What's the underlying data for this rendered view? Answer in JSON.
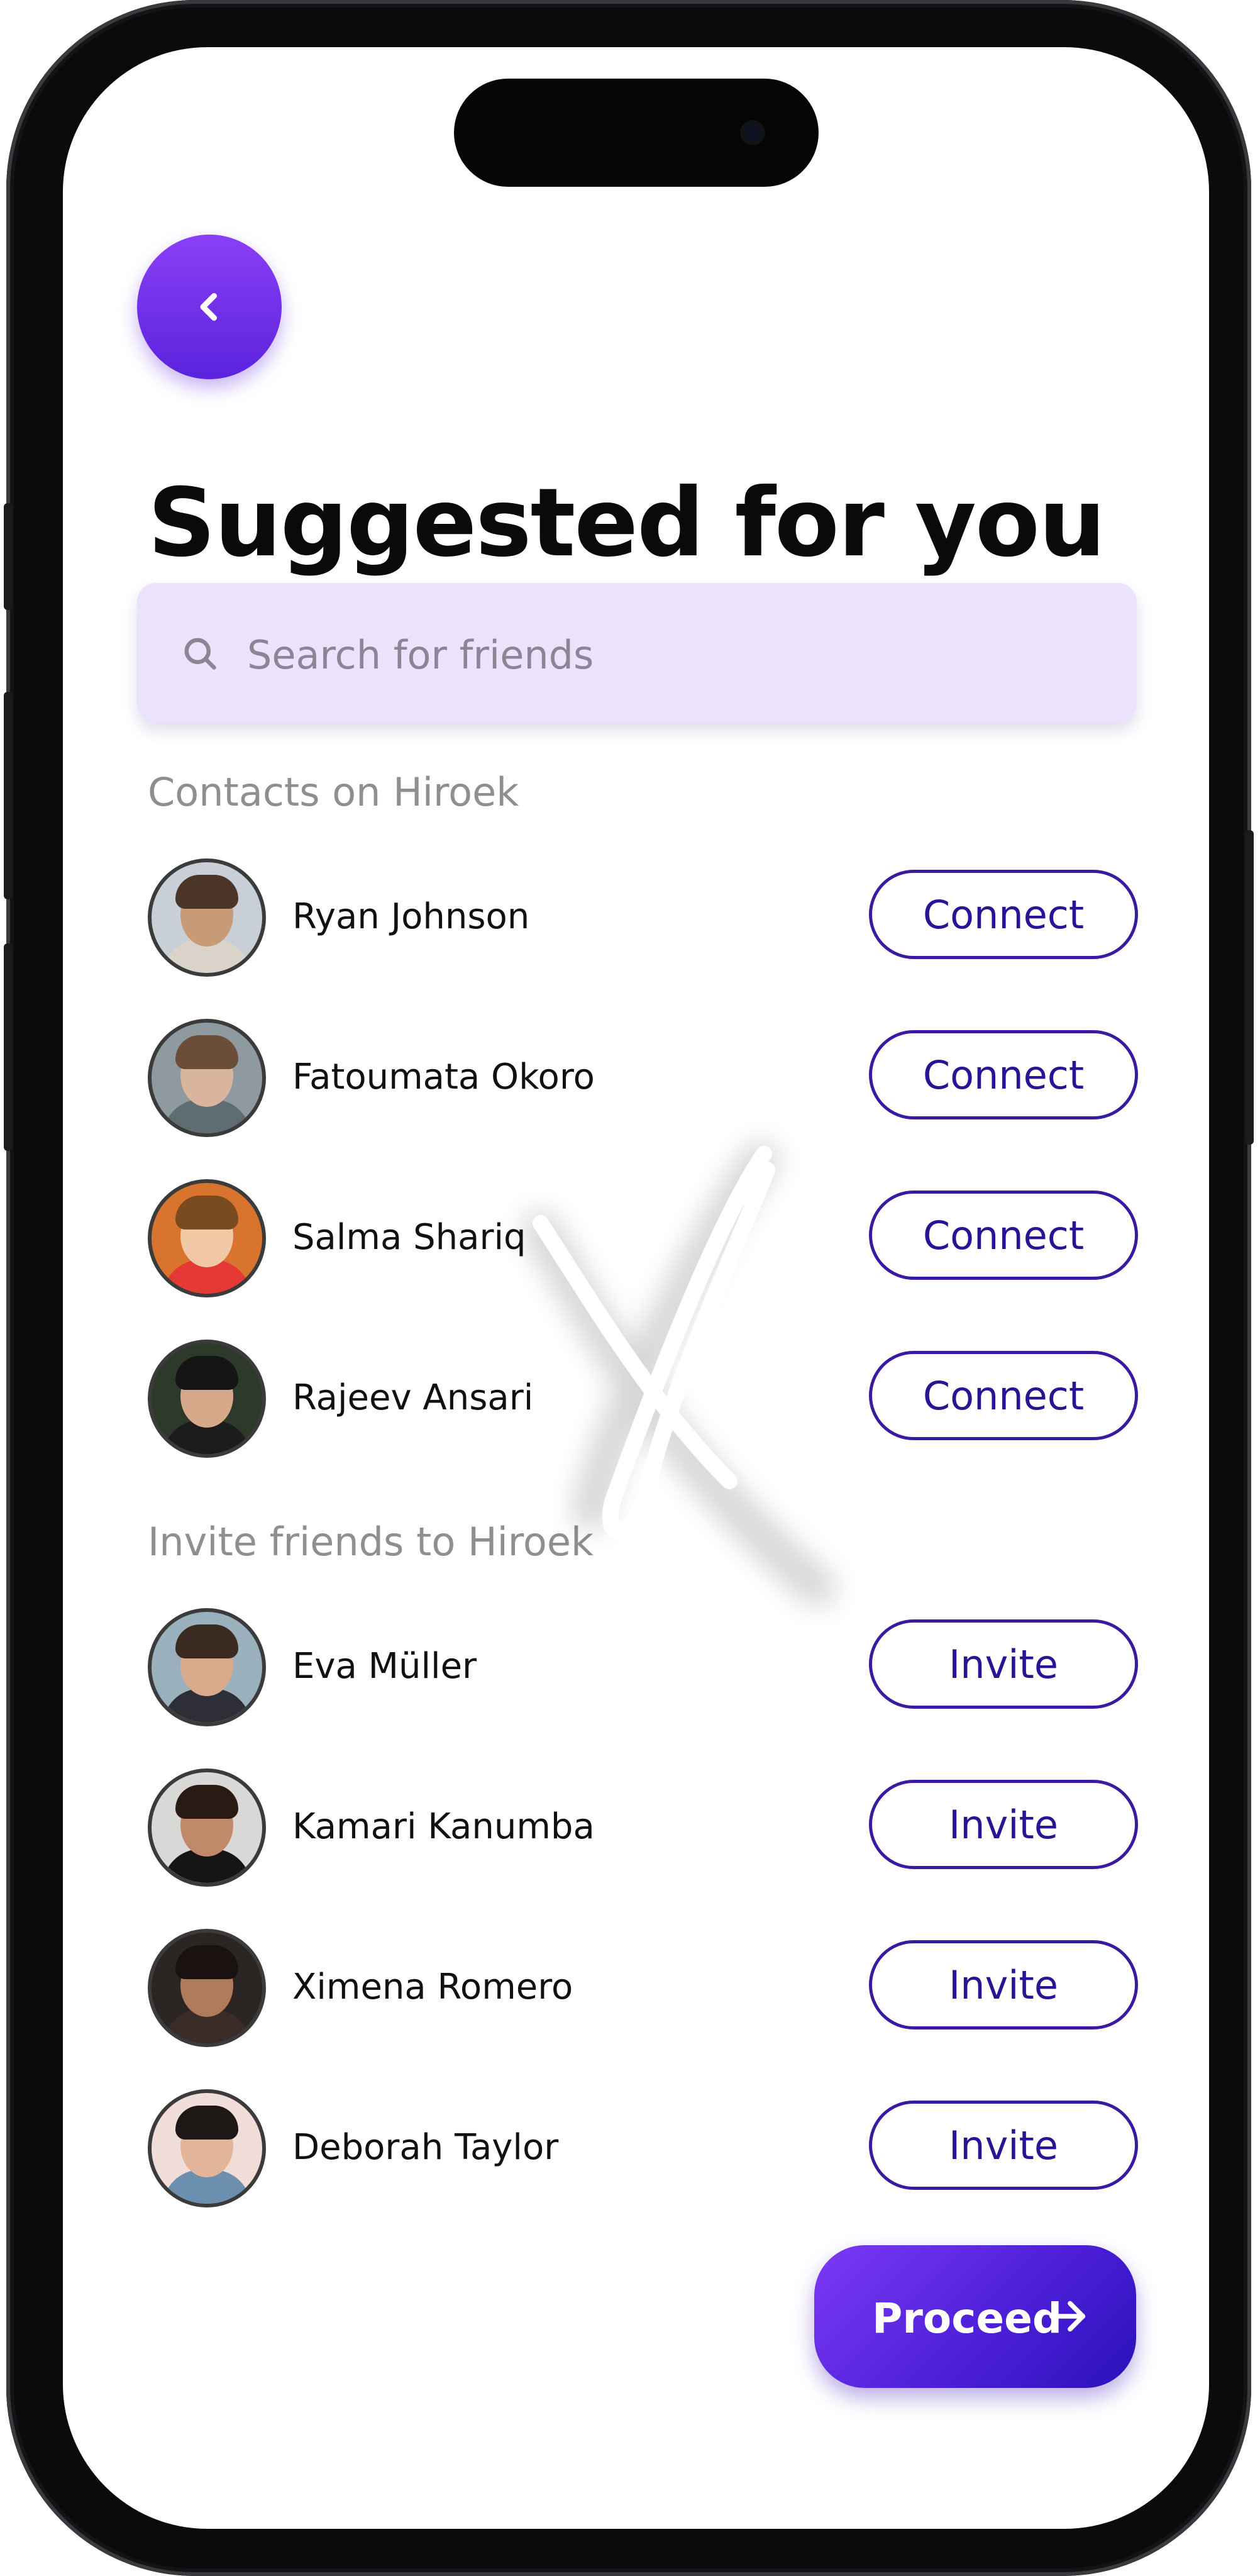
{
  "header": {
    "title": "Suggested for you"
  },
  "search": {
    "placeholder": "Search for friends"
  },
  "contacts_section": {
    "label": "Contacts on Hiroek",
    "items": [
      {
        "name": "Ryan Johnson",
        "action": "Connect"
      },
      {
        "name": "Fatoumata Okoro",
        "action": "Connect"
      },
      {
        "name": "Salma Shariq",
        "action": "Connect"
      },
      {
        "name": "Rajeev Ansari",
        "action": "Connect"
      }
    ]
  },
  "invite_section": {
    "label": "Invite friends to Hiroek",
    "items": [
      {
        "name": "Eva Müller",
        "action": "Invite"
      },
      {
        "name": "Kamari Kanumba",
        "action": "Invite"
      },
      {
        "name": "Ximena Romero",
        "action": "Invite"
      },
      {
        "name": "Deborah Taylor",
        "action": "Invite"
      }
    ]
  },
  "footer": {
    "proceed_label": "Proceed"
  },
  "colors": {
    "accent": "#5b23dc",
    "accent_light": "#8a3ff7",
    "search_bg": "#ebe3fc",
    "pill_border": "#3a1aa0",
    "label_gray": "#8f8f8f"
  },
  "icons": {
    "back": "chevron-left-icon",
    "search": "search-icon",
    "proceed": "arrow-right-icon"
  }
}
